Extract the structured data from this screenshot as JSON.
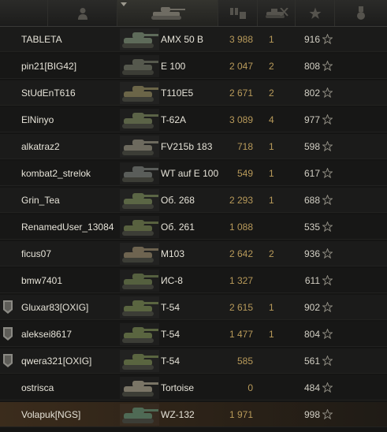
{
  "rows": [
    {
      "name": "TABLETA",
      "vehicle": "AMX 50 B",
      "damage": "3 988",
      "kills": "1",
      "xp": "916",
      "badge": false,
      "self": false,
      "tank_color": "#5e6b5a"
    },
    {
      "name": "pin21[BIG42]",
      "vehicle": "E 100",
      "damage": "2 047",
      "kills": "2",
      "xp": "808",
      "badge": false,
      "self": false,
      "tank_color": "#55584d"
    },
    {
      "name": "StUdEnT616",
      "vehicle": "T110E5",
      "damage": "2 671",
      "kills": "2",
      "xp": "802",
      "badge": false,
      "self": false,
      "tank_color": "#6b6548"
    },
    {
      "name": "ElNinyo",
      "vehicle": "T-62A",
      "damage": "3 089",
      "kills": "4",
      "xp": "977",
      "badge": false,
      "self": false,
      "tank_color": "#5b6347"
    },
    {
      "name": "alkatraz2",
      "vehicle": "FV215b 183",
      "damage": "718",
      "kills": "1",
      "xp": "598",
      "badge": false,
      "self": false,
      "tank_color": "#6d6a5e"
    },
    {
      "name": "kombat2_strelok",
      "vehicle": "WT auf E 100",
      "damage": "549",
      "kills": "1",
      "xp": "617",
      "badge": false,
      "self": false,
      "tank_color": "#5a5d5a"
    },
    {
      "name": "Grin_Tea",
      "vehicle": "Об. 268",
      "damage": "2 293",
      "kills": "1",
      "xp": "688",
      "badge": false,
      "self": false,
      "tank_color": "#5b6645"
    },
    {
      "name": "RenamedUser_13084",
      "vehicle": "Об. 261",
      "damage": "1 088",
      "kills": "",
      "xp": "535",
      "badge": false,
      "self": false,
      "tank_color": "#58613f"
    },
    {
      "name": "ficus07",
      "vehicle": "M103",
      "damage": "2 642",
      "kills": "2",
      "xp": "936",
      "badge": false,
      "self": false,
      "tank_color": "#6e6450"
    },
    {
      "name": "bmw7401",
      "vehicle": "ИС-8",
      "damage": "1 327",
      "kills": "",
      "xp": "611",
      "badge": false,
      "self": false,
      "tank_color": "#55603f"
    },
    {
      "name": "Gluxar83[OXIG]",
      "vehicle": "T-54",
      "damage": "2 615",
      "kills": "1",
      "xp": "902",
      "badge": true,
      "self": false,
      "tank_color": "#5a6540"
    },
    {
      "name": "aleksei8617",
      "vehicle": "T-54",
      "damage": "1 477",
      "kills": "1",
      "xp": "804",
      "badge": true,
      "self": false,
      "tank_color": "#5a6540"
    },
    {
      "name": "qwera321[OXIG]",
      "vehicle": "T-54",
      "damage": "585",
      "kills": "",
      "xp": "561",
      "badge": true,
      "self": false,
      "tank_color": "#5a6540"
    },
    {
      "name": "ostrisca",
      "vehicle": "Tortoise",
      "damage": "0",
      "kills": "",
      "xp": "484",
      "badge": false,
      "self": false,
      "tank_color": "#7a7566"
    },
    {
      "name": "Volapuk[NGS]",
      "vehicle": "WZ-132",
      "damage": "1 971",
      "kills": "",
      "xp": "998",
      "badge": false,
      "self": true,
      "tank_color": "#4f6a55"
    }
  ],
  "colors": {
    "damage": "#b89a5a",
    "self_highlight": "#3b2c1c",
    "text": "#e6e3d8"
  },
  "header_icons": [
    "player-icon",
    "sort-chevron-icon",
    "tank-icon",
    "damage-icon",
    "kills-icon",
    "xp-star-icon",
    "medal-icon"
  ]
}
